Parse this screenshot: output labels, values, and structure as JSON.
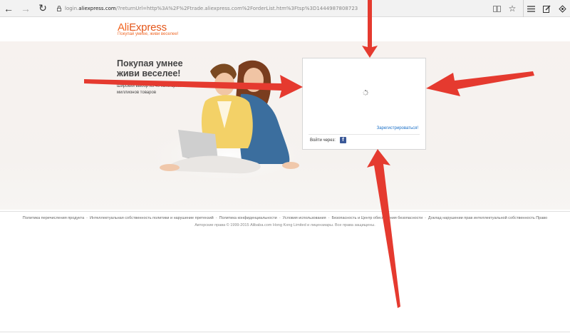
{
  "browser": {
    "url_prefix": "login.",
    "url_domain": "aliexpress.com",
    "url_rest": "/?returnUrl=http%3A%2F%2Ftrade.aliexpress.com%2ForderList.htm%3Ftsp%3D1444987808723",
    "icons": [
      "back-arrow",
      "forward-arrow",
      "refresh",
      "lock",
      "reading-view",
      "favorite-star",
      "hub-menu",
      "web-note",
      "share"
    ]
  },
  "header": {
    "logo_ali": "Ali",
    "logo_express": "Express",
    "tagline": "Покупай умнее, живи веселее!"
  },
  "hero": {
    "title_line1": "Покупая умнее",
    "title_line2": "живи веселее!",
    "subtitle_line1": "Широкий выбор из 40 категорий",
    "subtitle_line2": "миллионов товаров"
  },
  "login": {
    "register_label": "Зарегистрироваться!",
    "signin_via_label": "Войти через:",
    "facebook_letter": "f"
  },
  "footer": {
    "links": [
      "Политика перечисления продукта",
      "Интеллектуальная собственность политики и нарушение претензий",
      "Политика конфиденциальности",
      "Условия использования",
      "Безопасность и Центр обеспечения безопасности",
      "Доклад нарушении прав интеллектуальной собственность Право"
    ],
    "copyright": "Авторские права © 1999-2015 Alibaba.com Hong Kong Limited и лицензиары. Все права защищены."
  },
  "colors": {
    "brand_orange": "#f26521",
    "link_blue": "#1a6fc7",
    "arrow_red": "#e53a2f",
    "facebook_blue": "#3b5998"
  }
}
